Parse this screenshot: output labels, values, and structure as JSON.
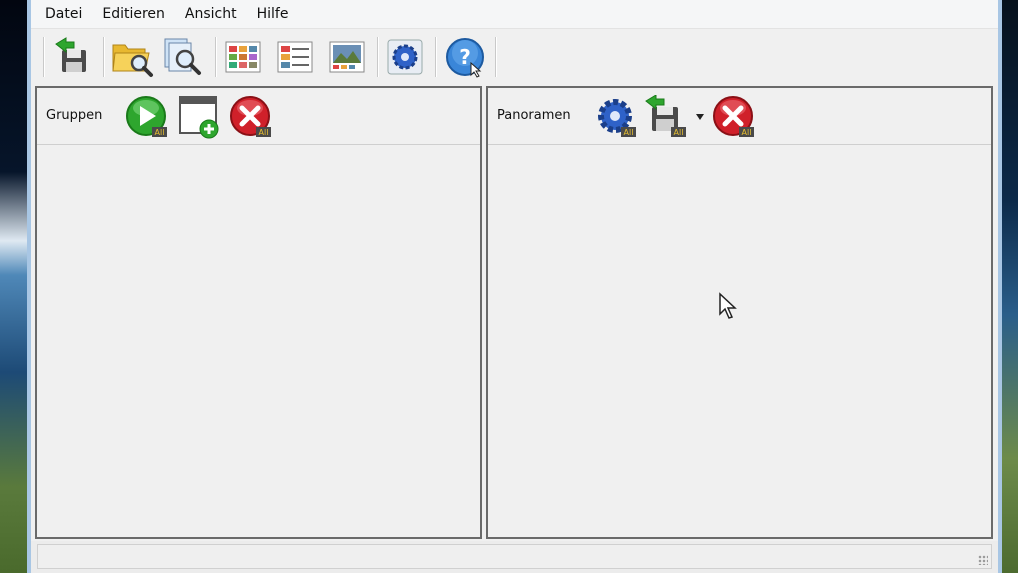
{
  "menu": [
    "Datei",
    "Editieren",
    "Ansicht",
    "Hilfe"
  ],
  "panels": {
    "groups_title": "Gruppen",
    "panoramas_title": "Panoramen"
  },
  "badge": "All",
  "colors": {
    "blue_icon": "#2f62c8",
    "green_icon": "#2ea62e",
    "red_icon": "#d0202a"
  },
  "toolbar_icons": [
    "save-icon",
    "open-folder-icon",
    "search-files-icon",
    "grid-view-icon",
    "list-view-icon",
    "image-view-icon",
    "settings-gear-icon",
    "help-icon"
  ],
  "panel_icons": [
    "play-all-icon",
    "add-group-icon",
    "delete-all-icon",
    "process-all-icon",
    "save-all-icon",
    "delete-all-panoramas-icon"
  ]
}
